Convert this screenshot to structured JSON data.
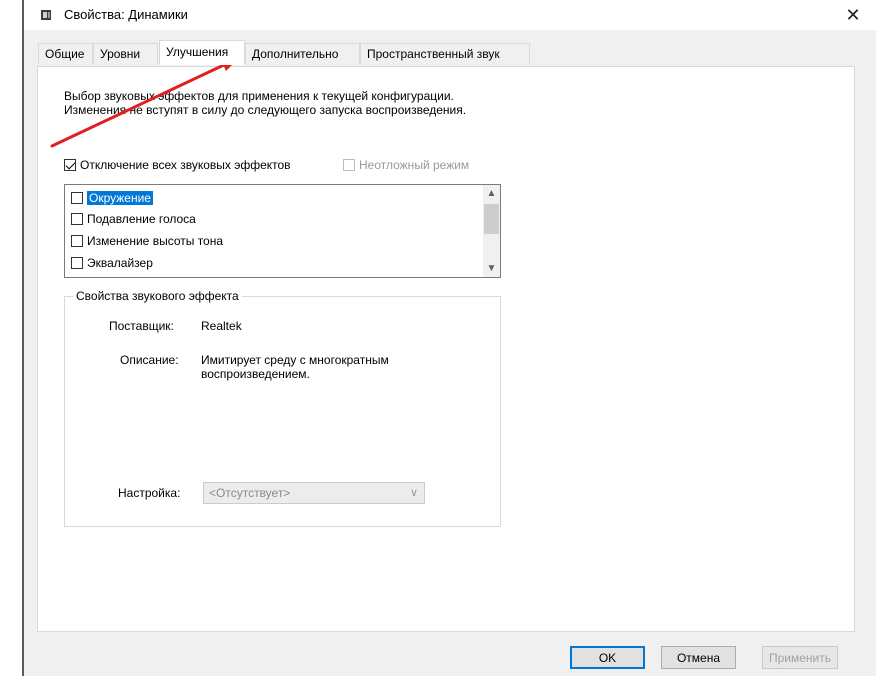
{
  "window": {
    "title": "Свойства: Динамики",
    "close_symbol": "✕"
  },
  "tabs": [
    {
      "label": "Общие"
    },
    {
      "label": "Уровни"
    },
    {
      "label": "Улучшения",
      "active": true
    },
    {
      "label": "Дополнительно"
    },
    {
      "label": "Пространственный звук"
    }
  ],
  "enhancements": {
    "description": "Выбор звуковых эффектов для применения к текущей конфигурации. Изменения не вступят в силу до следующего запуска воспроизведения.",
    "disable_all_label": "Отключение всех звуковых эффектов",
    "disable_all_checked": true,
    "immediate_mode_label": "Неотложный режим",
    "immediate_mode_enabled": false,
    "effects": [
      {
        "label": "Окружение",
        "checked": false,
        "selected": true
      },
      {
        "label": "Подавление голоса",
        "checked": false
      },
      {
        "label": "Изменение высоты тона",
        "checked": false
      },
      {
        "label": "Эквалайзер",
        "checked": false
      }
    ]
  },
  "effect_properties": {
    "group_title": "Свойства звукового эффекта",
    "provider_label": "Поставщик:",
    "provider_value": "Realtek",
    "description_label": "Описание:",
    "description_value_line1": "Имитирует среду с многократным",
    "description_value_line2": "воспроизведением.",
    "setting_label": "Настройка:",
    "setting_value": "<Отсутствует>"
  },
  "buttons": {
    "ok": "OK",
    "cancel": "Отмена",
    "apply": "Применить"
  },
  "colors": {
    "selection": "#0078d7",
    "annotation_arrow": "#e02020"
  }
}
